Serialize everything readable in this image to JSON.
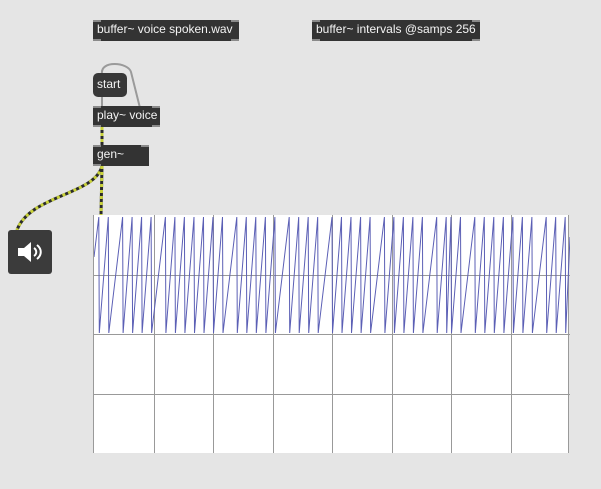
{
  "objects": {
    "buffer_voice": "buffer~ voice spoken.wav",
    "buffer_intervals": "buffer~ intervals @samps 256",
    "play": "play~ voice",
    "gen": "gen~"
  },
  "messages": {
    "start": "start"
  },
  "icons": {
    "dac": "speaker-icon"
  },
  "colors": {
    "background": "#e5e5e5",
    "object_box": "#333333",
    "signal_wire": "#c9d23a",
    "plot_line": "#5b5fb5",
    "grid": "#999999"
  },
  "plot": {
    "drop_fractions": [
      0.01,
      0.03,
      0.06,
      0.08,
      0.1,
      0.12,
      0.15,
      0.17,
      0.19,
      0.21,
      0.23,
      0.25,
      0.27,
      0.3,
      0.32,
      0.34,
      0.36,
      0.38,
      0.41,
      0.43,
      0.45,
      0.47,
      0.5,
      0.52,
      0.54,
      0.56,
      0.58,
      0.61,
      0.63,
      0.65,
      0.67,
      0.69,
      0.72,
      0.74,
      0.75,
      0.77,
      0.8,
      0.82,
      0.84,
      0.86,
      0.88,
      0.9,
      0.92,
      0.95,
      0.97,
      0.99
    ],
    "gaps": [
      [
        0.75,
        0.79
      ]
    ],
    "columns": 8,
    "rows": 4
  }
}
